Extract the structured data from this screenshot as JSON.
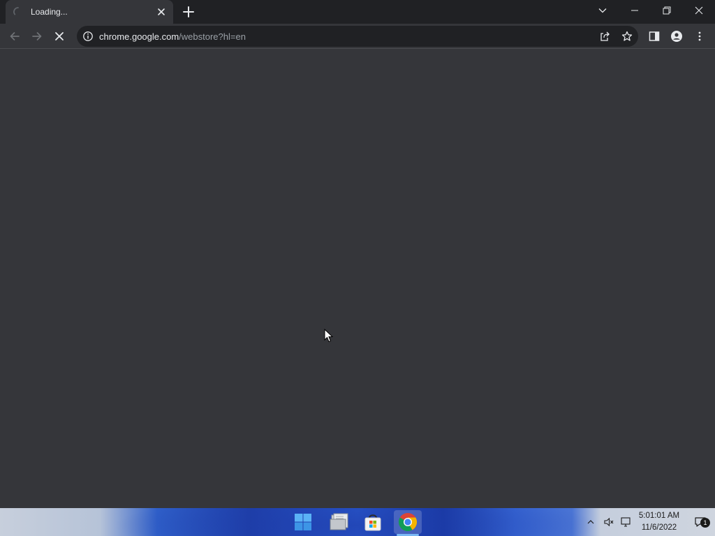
{
  "browser": {
    "tab": {
      "title": "Loading...",
      "loading": true
    },
    "address_bar": {
      "host": "chrome.google.com",
      "path": "/webstore?hl=en"
    },
    "navigation": {
      "back_enabled": false,
      "forward_enabled": false,
      "reload_state": "stop"
    }
  },
  "taskbar": {
    "apps": [
      {
        "name": "Start",
        "icon": "windows-logo-icon"
      },
      {
        "name": "File Explorer",
        "icon": "file-explorer-icon"
      },
      {
        "name": "Microsoft Store",
        "icon": "microsoft-store-icon"
      },
      {
        "name": "Google Chrome",
        "icon": "chrome-icon",
        "active": true
      }
    ],
    "clock": {
      "time": "5:01:01 AM",
      "date": "11/6/2022"
    },
    "notification_count": "1"
  },
  "colors": {
    "tabstrip_bg": "#202124",
    "toolbar_bg": "#35363a",
    "content_bg": "#35363a",
    "omnibox_bg": "#202124",
    "text_primary": "#e8eaed",
    "text_secondary": "#9aa0a6"
  }
}
